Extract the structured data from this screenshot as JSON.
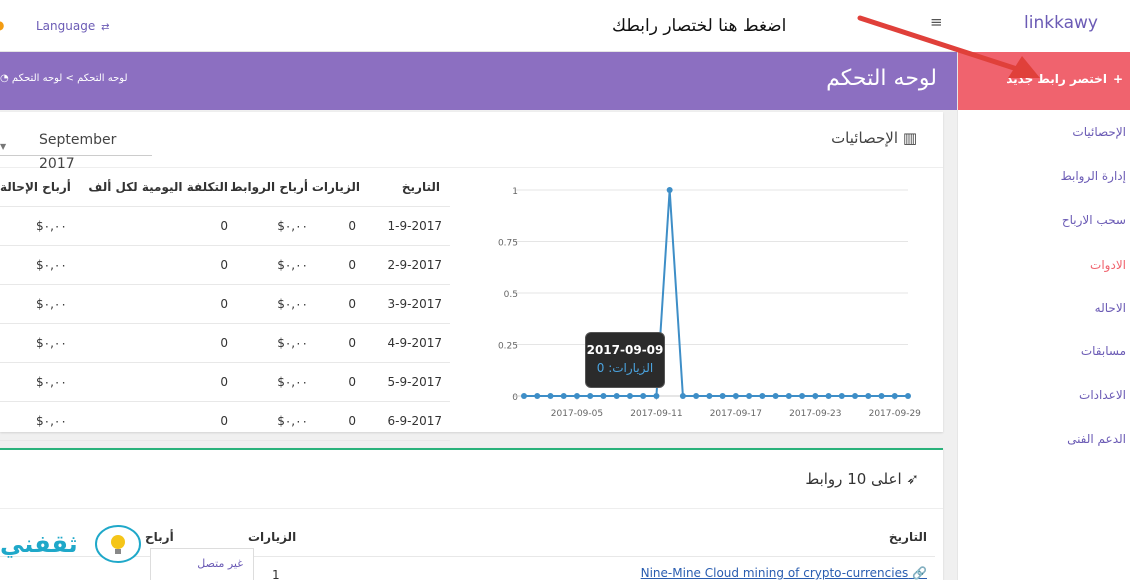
{
  "topbar": {
    "language_label": "Language",
    "annotation": "اضغط هنا لختصار رابطك"
  },
  "brand": {
    "name": "linkkawy"
  },
  "sidebar": {
    "shorten_button": "اختصر رابط جديد",
    "items": [
      {
        "label": "الإحصائيات"
      },
      {
        "label": "إدارة الروابط"
      },
      {
        "label": "سحب الارباح"
      },
      {
        "label": "الادوات"
      },
      {
        "label": "الاحاله"
      },
      {
        "label": "مسابقات"
      },
      {
        "label": "الاعدادات"
      },
      {
        "label": "الدعم الفنى"
      }
    ]
  },
  "header": {
    "title": "لوحه التحكم",
    "breadcrumb_home": "لوحه التحكم",
    "breadcrumb_sep": ">",
    "breadcrumb_current": "لوحه التحكم"
  },
  "stats": {
    "title": "الإحصائيات",
    "month": "September 2017",
    "columns": [
      "التاريخ",
      "الزيارات",
      "أرباح الروابط",
      "التكلفة اليومية لكل ألف",
      "أرباح الإحالة"
    ],
    "rows": [
      [
        "1-9-2017",
        "0",
        "$٠,٠٠",
        "0",
        "$٠,٠٠"
      ],
      [
        "2-9-2017",
        "0",
        "$٠,٠٠",
        "0",
        "$٠,٠٠"
      ],
      [
        "3-9-2017",
        "0",
        "$٠,٠٠",
        "0",
        "$٠,٠٠"
      ],
      [
        "4-9-2017",
        "0",
        "$٠,٠٠",
        "0",
        "$٠,٠٠"
      ],
      [
        "5-9-2017",
        "0",
        "$٠,٠٠",
        "0",
        "$٠,٠٠"
      ],
      [
        "6-9-2017",
        "0",
        "$٠,٠٠",
        "0",
        "$٠,٠٠"
      ]
    ],
    "tooltip_date": "2017-09-09",
    "tooltip_value": "الزيارات: 0"
  },
  "chart_data": {
    "type": "line",
    "x": [
      "2017-09-01",
      "2017-09-02",
      "2017-09-03",
      "2017-09-04",
      "2017-09-05",
      "2017-09-06",
      "2017-09-07",
      "2017-09-08",
      "2017-09-09",
      "2017-09-10",
      "2017-09-11",
      "2017-09-12",
      "2017-09-13",
      "2017-09-14",
      "2017-09-15",
      "2017-09-16",
      "2017-09-17",
      "2017-09-18",
      "2017-09-19",
      "2017-09-20",
      "2017-09-21",
      "2017-09-22",
      "2017-09-23",
      "2017-09-24",
      "2017-09-25",
      "2017-09-26",
      "2017-09-27",
      "2017-09-28",
      "2017-09-29",
      "2017-09-30"
    ],
    "series": [
      {
        "values": [
          0,
          0,
          0,
          0,
          0,
          0,
          0,
          0,
          0,
          0,
          0,
          1,
          0,
          0,
          0,
          0,
          0,
          0,
          0,
          0,
          0,
          0,
          0,
          0,
          0,
          0,
          0,
          0,
          0,
          0
        ]
      }
    ],
    "ylim": [
      0,
      1
    ],
    "yticks": [
      "0",
      "0.25",
      "0.5",
      "0.75",
      "1"
    ],
    "xticks": [
      "2017-09-05",
      "2017-09-11",
      "2017-09-17",
      "2017-09-23",
      "2017-09-29"
    ],
    "grid": true,
    "color": "#3e8ec7"
  },
  "top_links": {
    "title": "اعلى 10 روابط",
    "col_date": "التاريخ",
    "col_visits": "الزيارات",
    "col_earnings": "أرباح",
    "row_link": "Nine-Mine Cloud mining of crypto-currencies",
    "row_visits": "1"
  },
  "chat": {
    "offline_label": "غير متصل"
  },
  "watermark": {
    "text": "ثقفني"
  },
  "colors": {
    "purple": "#8c6fc1",
    "red": "#f0636e",
    "accent": "#6b5bb5",
    "green": "#2ab27b"
  }
}
